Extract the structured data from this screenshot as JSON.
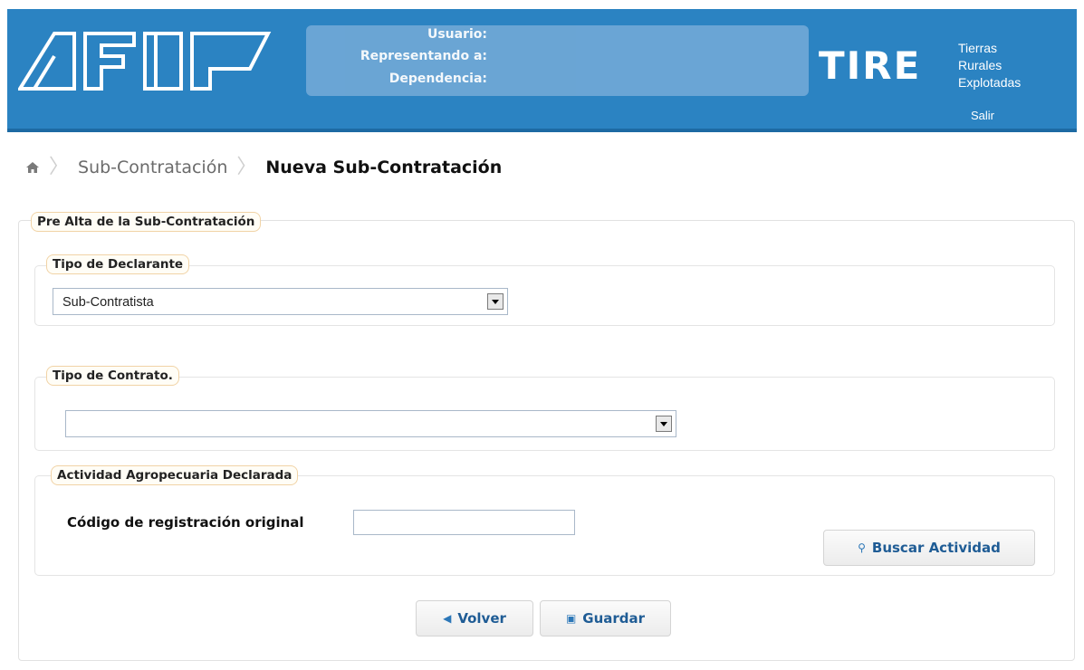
{
  "header": {
    "logo_text": "AFIP",
    "user_labels": [
      "Usuario:",
      "Representando a:",
      "Dependencia:"
    ],
    "system_name": "TIRE",
    "system_desc": [
      "Tierras",
      "Rurales",
      "Explotadas"
    ],
    "logout": "Salir"
  },
  "breadcrumb": {
    "home_icon": "home-icon",
    "parent": "Sub-Contratación",
    "current": "Nueva Sub-Contratación"
  },
  "form": {
    "panel_title": "Pre Alta de la Sub-Contratación",
    "tipo_declarante": {
      "legend": "Tipo de Declarante",
      "selected": "Sub-Contratista"
    },
    "tipo_contrato": {
      "legend": "Tipo de Contrato.",
      "selected": ""
    },
    "actividad": {
      "legend": "Actividad Agropecuaria Declarada",
      "codigo_label": "Código de registración original",
      "codigo_value": "",
      "buscar_label": "Buscar Actividad"
    },
    "buttons": {
      "volver": "Volver",
      "guardar": "Guardar"
    }
  },
  "colors": {
    "header_blue": "#2b83c2",
    "userbox_blue": "#6ea7d6",
    "button_text": "#1f5c95",
    "legend_border": "#f1d3a6"
  }
}
